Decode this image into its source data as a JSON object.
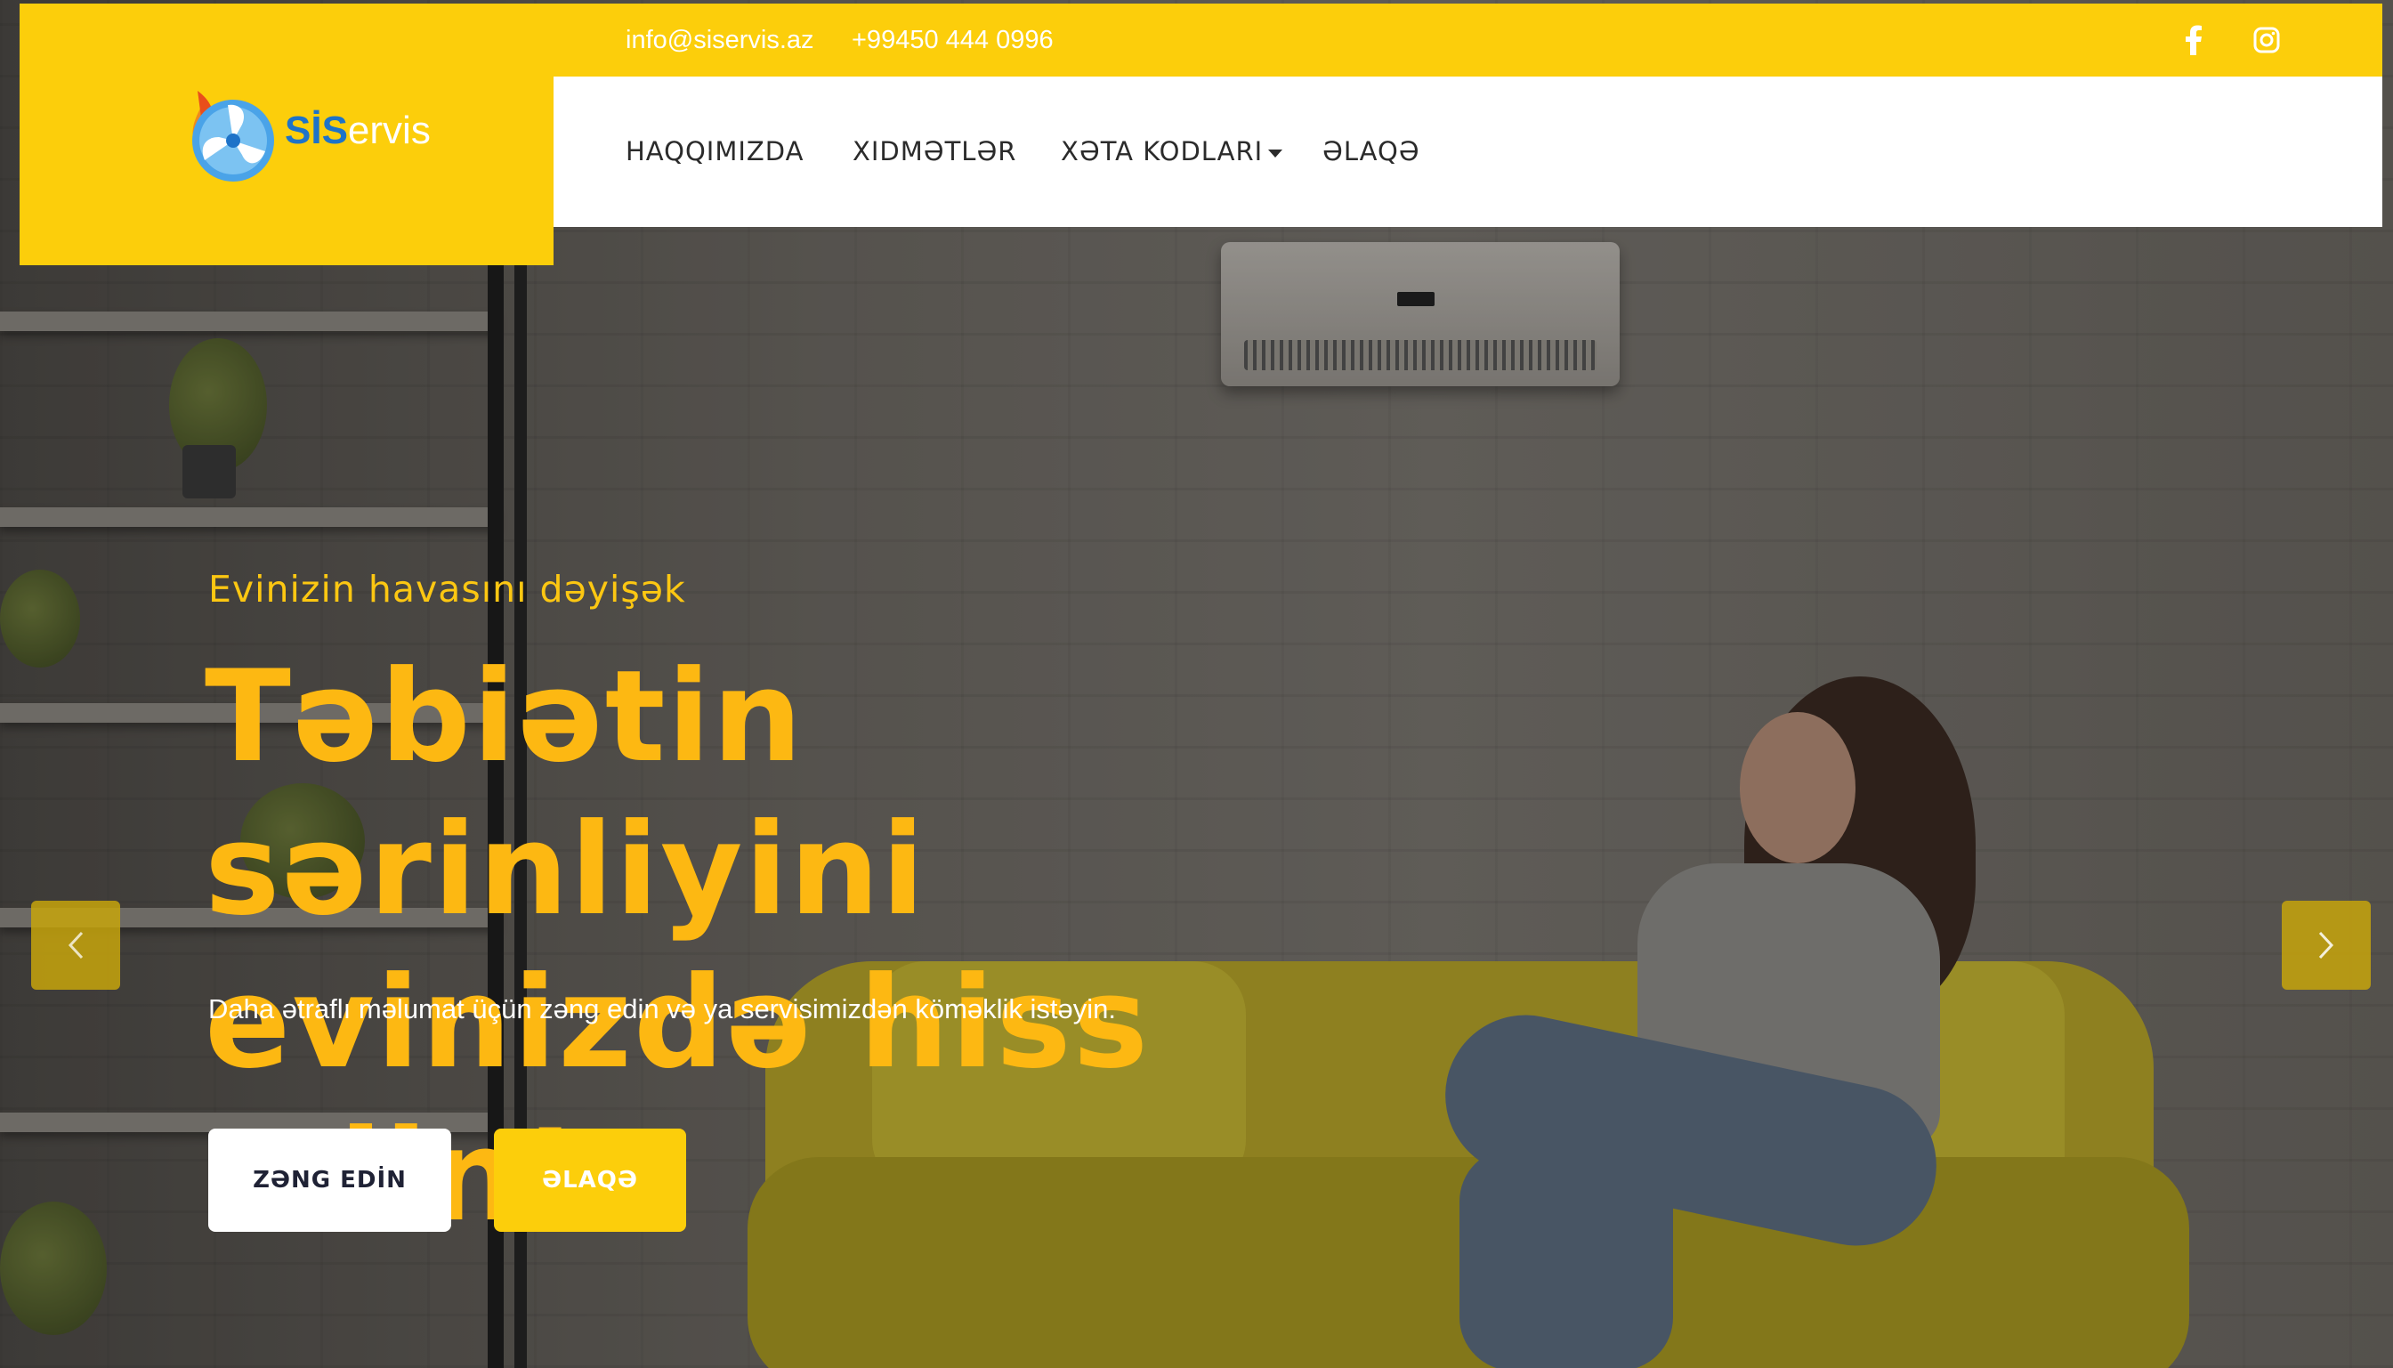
{
  "topbar": {
    "email": "info@siservis.az",
    "phone": "+99450 444 0996",
    "social": [
      "facebook-icon",
      "instagram-icon"
    ]
  },
  "logo": {
    "text_bold": "SİS",
    "text_rest": "ervis"
  },
  "nav": {
    "items": [
      {
        "label": "HAQQIMIZDA"
      },
      {
        "label": "XIDMƏTLƏR"
      },
      {
        "label": "XƏTA KODLARI",
        "dropdown": true
      },
      {
        "label": "ƏLAQƏ"
      }
    ]
  },
  "hero": {
    "eyebrow": "Evinizin havasını dəyişək",
    "headline_line1": "Təbiətin sərinliyini",
    "headline_line2": "evinizdə hiss edin!",
    "subtext": "Daha ətraflı məlumat üçün zəng edin və ya servisimizdən köməklik istəyin.",
    "button_call": "ZƏNG EDİN",
    "button_contact": "ƏLAQƏ"
  },
  "colors": {
    "brand_yellow": "#fcce0b",
    "headline_orange": "#fdb812",
    "logo_blue": "#1e73c8"
  }
}
